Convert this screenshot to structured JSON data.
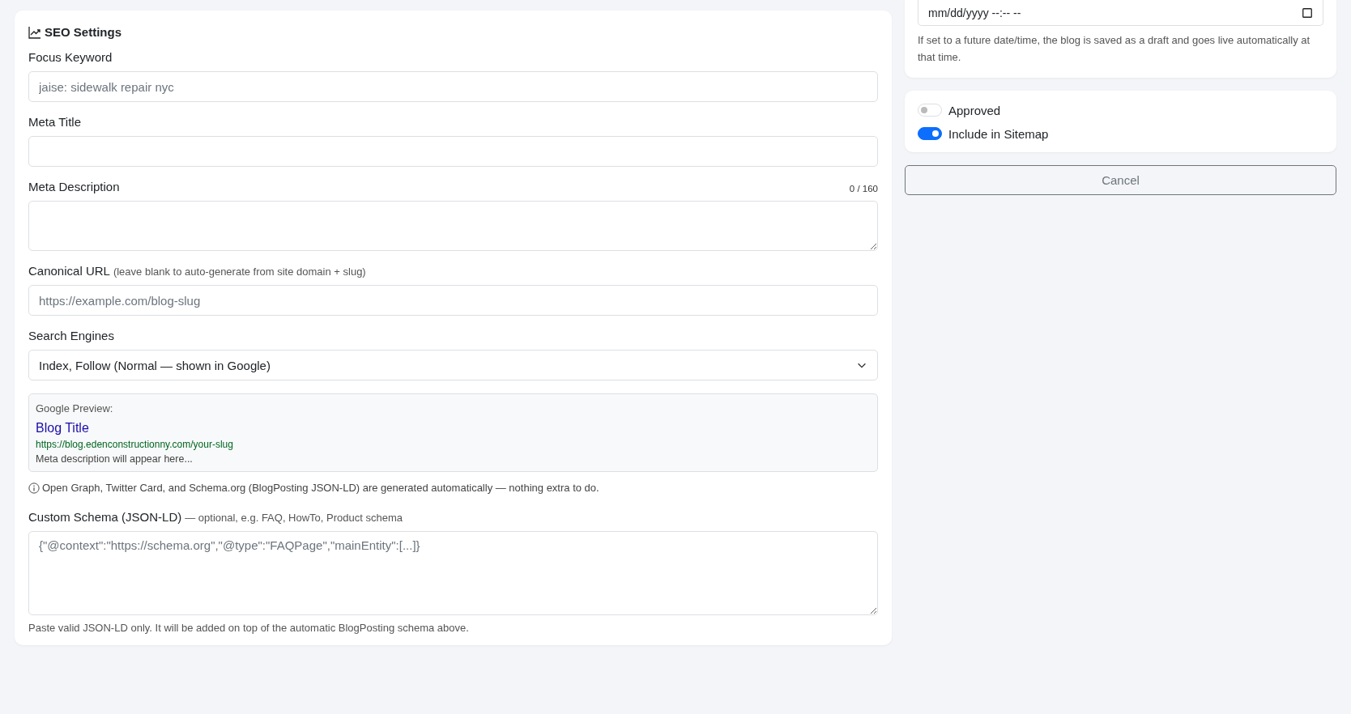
{
  "seo": {
    "title": "SEO Settings",
    "fields": [
      {
        "kind": "input",
        "label": "Focus Keyword",
        "placeholder": "jaise: sidewalk repair nyc"
      },
      {
        "kind": "input",
        "label": "Meta Title"
      },
      {
        "kind": "textarea",
        "label": "Meta Description",
        "counter": "0 / 160"
      },
      {
        "kind": "input",
        "label": "Canonical URL",
        "hint": "(leave blank to auto-generate from site domain + slug)",
        "placeholder": "https://example.com/blog-slug"
      },
      {
        "kind": "select",
        "label": "Search Engines",
        "value": "Index, Follow (Normal — shown in Google)"
      }
    ],
    "google_preview": {
      "heading": "Google Preview:",
      "title": "Blog Title",
      "url": "https://blog.edenconstructionny.com/your-slug",
      "description": "Meta description will appear here..."
    },
    "info_note": "Open Graph, Twitter Card, and Schema.org (BlogPosting JSON-LD) are generated automatically — nothing extra to do.",
    "custom_schema": {
      "label": "Custom Schema (JSON-LD)",
      "hint": "— optional, e.g. FAQ, HowTo, Product schema",
      "placeholder": "{\"@context\":\"https://schema.org\",\"@type\":\"FAQPage\",\"mainEntity\":[...]}",
      "help": "Paste valid JSON-LD only. It will be added on top of the automatic BlogPosting schema above."
    }
  },
  "right_panel": {
    "schedule_field": {
      "placeholder": "mm/dd/yyyy --:-- --"
    },
    "schedule_help": "If set to a future date/time, the blog is saved as a draft and goes live automatically at that time.",
    "toggles": [
      {
        "label": "Approved",
        "on": false
      },
      {
        "label": "Include in Sitemap",
        "on": true
      }
    ],
    "cancel_button": "Cancel"
  }
}
